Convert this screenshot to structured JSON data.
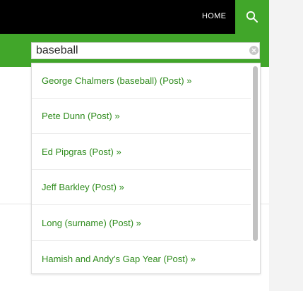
{
  "header": {
    "home_label": "HOME",
    "search_icon": "search-icon"
  },
  "search": {
    "value": "baseball",
    "clear_icon": "clear-icon"
  },
  "results": [
    {
      "label": "George Chalmers (baseball) (Post) »"
    },
    {
      "label": "Pete Dunn (Post) »"
    },
    {
      "label": "Ed Pipgras (Post) »"
    },
    {
      "label": "Jeff Barkley (Post) »"
    },
    {
      "label": "Long (surname) (Post) »"
    },
    {
      "label": "Hamish and Andy’s Gap Year (Post) »"
    }
  ],
  "colors": {
    "accent": "#41a62a",
    "link": "#2e8b1c",
    "topbar": "#000000"
  }
}
